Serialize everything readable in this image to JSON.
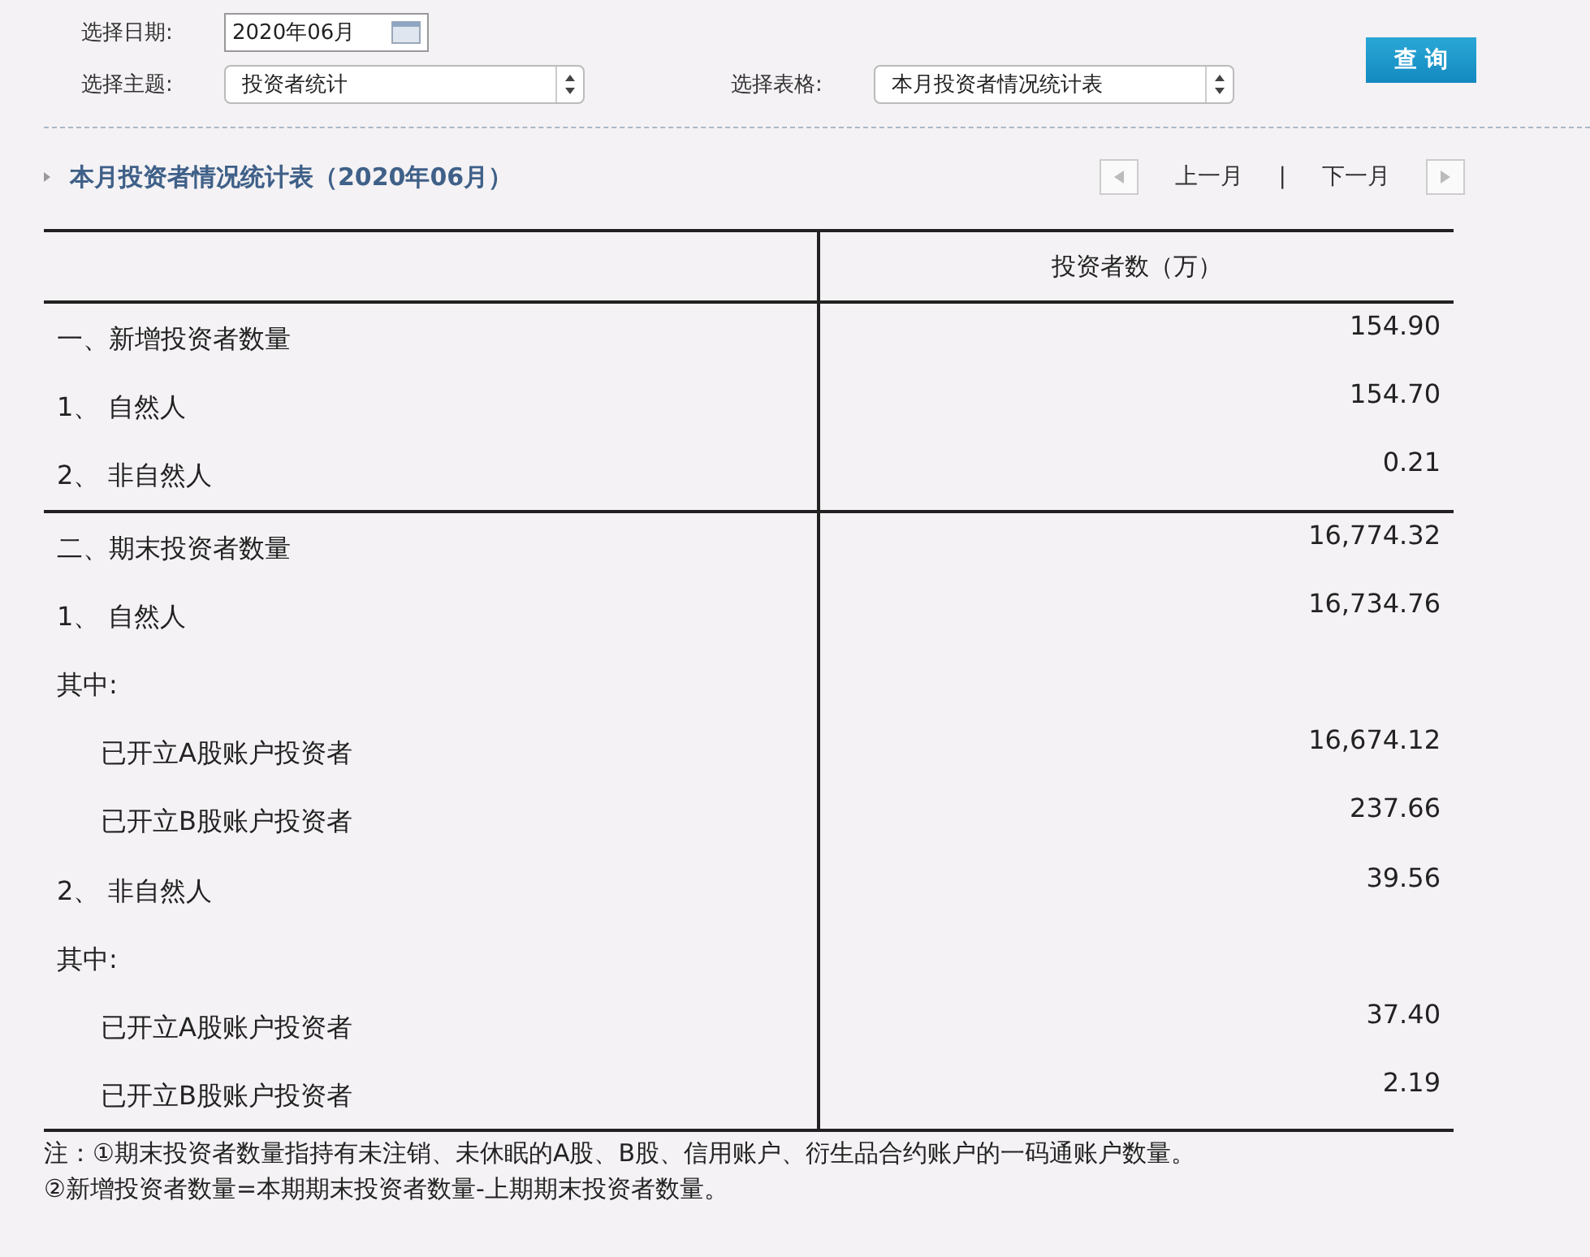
{
  "filters": {
    "date_label": "选择日期:",
    "date_value": "2020年06月",
    "topic_label": "选择主题:",
    "topic_value": "投资者统计",
    "table_label": "选择表格:",
    "table_value": "本月投资者情况统计表",
    "query_button": "查 询"
  },
  "report": {
    "title": "本月投资者情况统计表（2020年06月）",
    "prev": "上一月",
    "separator": "|",
    "next": "下一月"
  },
  "table": {
    "column_2": "投资者数（万）",
    "sections": [
      {
        "label": "一、新增投资者数量",
        "value": "154.90",
        "children": [
          {
            "label": "1、 自然人",
            "value": "154.70"
          },
          {
            "label": "2、 非自然人",
            "value": "0.21"
          }
        ]
      },
      {
        "label": "二、期末投资者数量",
        "value": "16,774.32",
        "children": [
          {
            "label": "1、 自然人",
            "value": "16,734.76"
          },
          {
            "label": "其中:",
            "children": [
              {
                "label": "已开立A股账户投资者",
                "value": "16,674.12"
              },
              {
                "label": "已开立B股账户投资者",
                "value": "237.66"
              }
            ]
          },
          {
            "label": "2、 非自然人",
            "value": "39.56"
          },
          {
            "label": "其中:",
            "children": [
              {
                "label": "已开立A股账户投资者",
                "value": "37.40"
              },
              {
                "label": "已开立B股账户投资者",
                "value": "2.19"
              }
            ]
          }
        ]
      }
    ]
  },
  "notes": [
    "注：①期末投资者数量指持有未注销、未休眠的A股、B股、信用账户、衍生品合约账户的一码通账户数量。",
    "②新增投资者数量=本期期末投资者数量-上期期末投资者数量。"
  ]
}
